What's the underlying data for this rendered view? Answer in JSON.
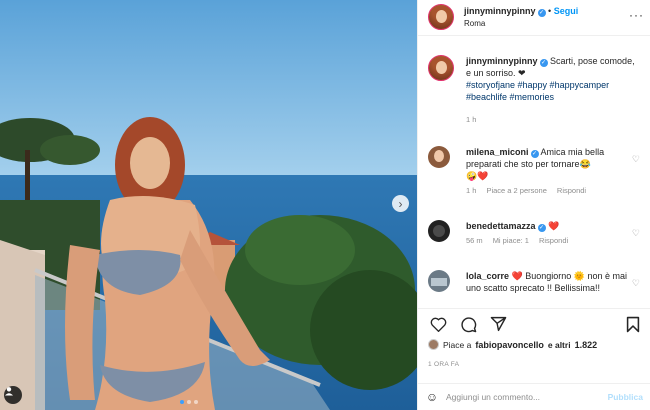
{
  "header": {
    "username": "jinnyminnypinny",
    "follow_label": "Segui",
    "location": "Roma",
    "more_icon": "more-horizontal-icon"
  },
  "caption": {
    "username": "jinnyminnypinny",
    "text": "Scarti, pose comode, e un sorriso. ❤︎",
    "hashtags": "#storyofjane #happy #happycamper #beachlife #memories",
    "time": "1 h"
  },
  "comments": [
    {
      "username": "milena_miconi",
      "text": "Amica mia bella preparati che sto per tornare😂",
      "second_line": "🤪❤️",
      "time": "1 h",
      "likes": "Piace a 2 persone",
      "reply": "Rispondi"
    },
    {
      "username": "benedettamazza",
      "text": "❤️",
      "time": "56 m",
      "likes": "Mi piace: 1",
      "reply": "Rispondi"
    },
    {
      "username": "lola_corre",
      "text": "❤️ Buongiorno 🌞 non è mai uno scatto sprecato !! Bellissima!!"
    }
  ],
  "likes": {
    "prefix": "Piace a",
    "user": "fabiopavoncello",
    "suffix": "e altri",
    "count": "1.822"
  },
  "date": "1 ORA FA",
  "comment_box": {
    "placeholder": "Aggiungi un commento...",
    "publish_label": "Pubblica"
  },
  "colors": {
    "accent": "#0095f6",
    "verified": "#3897f0",
    "heart": "#ed4956",
    "muted": "#8e8e8e"
  }
}
